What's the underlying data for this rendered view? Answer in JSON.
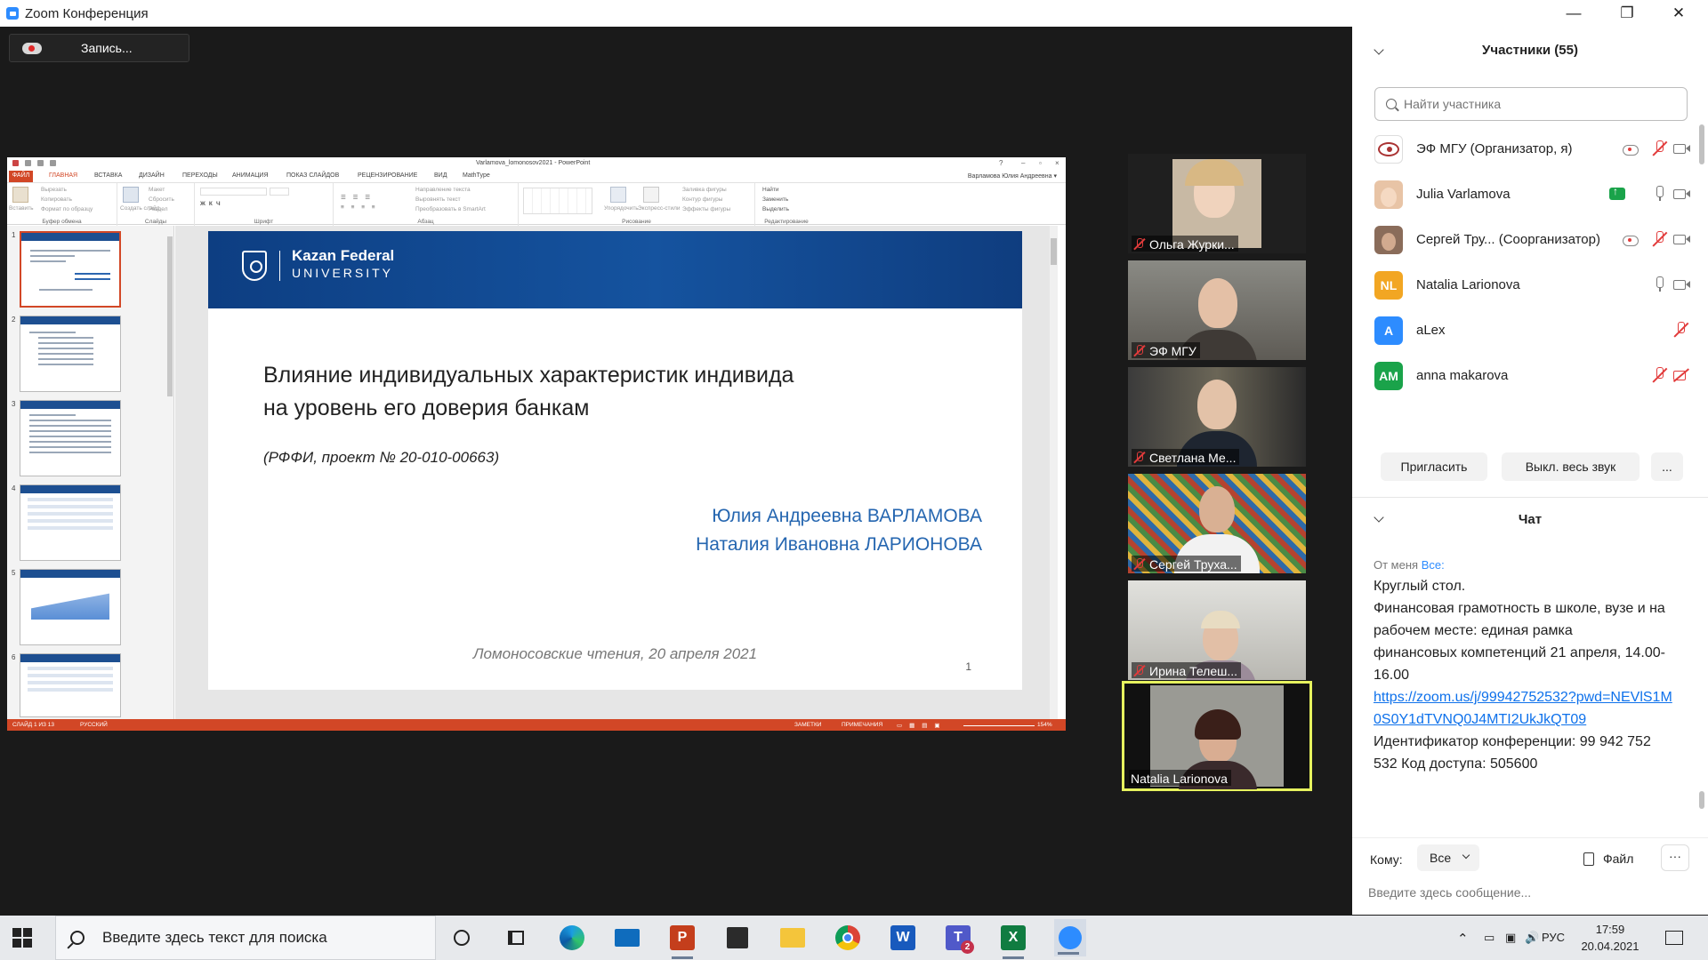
{
  "window": {
    "title": "Zoom Конференция",
    "minimize": "—",
    "restore": "❐",
    "close": "✕"
  },
  "recording": {
    "label": "Запись..."
  },
  "powerpoint": {
    "doc_title": "Varlamova_lomonosov2021 - PowerPoint",
    "tabs": [
      "ФАЙЛ",
      "ГЛАВНАЯ",
      "ВСТАВКА",
      "ДИЗАЙН",
      "ПЕРЕХОДЫ",
      "АНИМАЦИЯ",
      "ПОКАЗ СЛАЙДОВ",
      "РЕЦЕНЗИРОВАНИЕ",
      "ВИД",
      "MathType"
    ],
    "user": "Варламова Юлия Андреевна ▾",
    "ribbon": {
      "clipboard": {
        "label": "Буфер обмена",
        "paste": "Вставить",
        "cut": "Вырезать",
        "copy": "Копировать",
        "format": "Формат по образцу"
      },
      "slides": {
        "label": "Слайды",
        "create": "Создать слайд",
        "layout": "Макет",
        "reset": "Сбросить",
        "section": "Раздел"
      },
      "font": {
        "label": "Шрифт"
      },
      "paragraph": {
        "label": "Абзац",
        "direction": "Направление текста",
        "align": "Выровнять текст",
        "smartart": "Преобразовать в SmartArt"
      },
      "drawing": {
        "label": "Рисование",
        "arrange": "Упорядочить",
        "quick": "Экспресс-стили",
        "fill": "Заливка фигуры",
        "outline": "Контур фигуры",
        "effects": "Эффекты фигуры"
      },
      "editing": {
        "label": "Редактирование",
        "find": "Найти",
        "replace": "Заменить",
        "select": "Выделить"
      }
    },
    "slide": {
      "logo_name": "Kazan Federal",
      "logo_sub": "UNIVERSITY",
      "title_line1": "Влияние индивидуальных характеристик индивида",
      "title_line2": "на уровень его доверия банкам",
      "grant": "(РФФИ, проект № 20-010-00663)",
      "author1": "Юлия Андреевна ВАРЛАМОВА",
      "author2": "Наталия Ивановна ЛАРИОНОВА",
      "footer": "Ломоносовские чтения, 20 апреля 2021",
      "number": "1"
    },
    "thumbnail_numbers": [
      "1",
      "2",
      "3",
      "4",
      "5",
      "6"
    ],
    "status": {
      "slide": "СЛАЙД 1 ИЗ 13",
      "lang": "РУССКИЙ",
      "notes": "ЗАМЕТКИ",
      "comments": "ПРИМЕЧАНИЯ",
      "zoom": "154%"
    }
  },
  "videos": [
    {
      "name": "Ольга Журки...",
      "muted": true
    },
    {
      "name": "ЭФ МГУ",
      "muted": true
    },
    {
      "name": "Светлана Ме...",
      "muted": true
    },
    {
      "name": "Сергей Труха...",
      "muted": true
    },
    {
      "name": "Ирина Телеш...",
      "muted": true
    },
    {
      "name": "Natalia Larionova",
      "muted": false,
      "active": true
    }
  ],
  "participants_panel": {
    "title": "Участники (55)",
    "search_placeholder": "Найти участника",
    "participants": [
      {
        "name": "ЭФ МГУ (Организатор, я)",
        "avatar": "",
        "avatar_color": "#ffffff"
      },
      {
        "name": "Julia Varlamova",
        "avatar": "",
        "avatar_color": "#e8c4a6"
      },
      {
        "name": "Сергей Тру... (Соорганизатор)",
        "avatar": "",
        "avatar_color": "#8a6c5a"
      },
      {
        "name": "Natalia Larionova",
        "avatar": "NL",
        "avatar_color": "#f2a623"
      },
      {
        "name": "aLex",
        "avatar": "A",
        "avatar_color": "#2d8cff"
      },
      {
        "name": "anna makarova",
        "avatar": "AM",
        "avatar_color": "#1aa34a"
      }
    ],
    "invite": "Пригласить",
    "mute_all": "Выкл. весь звук",
    "more": "..."
  },
  "chat": {
    "title": "Чат",
    "from_label": "От меня",
    "to_label": "Все:",
    "message_lines": [
      "Круглый стол.",
      "Финансовая грамотность в школе, вузе и на рабочем месте: единая рамка",
      "финансовых компетенций 21 апреля, 14.00-16.00"
    ],
    "link": "https://zoom.us/j/99942752532?pwd=NEVlS1M0S0Y1dTVNQ0J4MTI2UkJkQT09",
    "message_tail": "Идентификатор конференции: 99 942 752 532 Код доступа: 505600",
    "to_prompt": "Кому:",
    "to_value": "Все",
    "file_label": "Файл",
    "more": "···",
    "input_placeholder": "Введите здесь сообщение..."
  },
  "taskbar": {
    "search_placeholder": "Введите здесь текст для поиска",
    "lang": "РУС",
    "time": "17:59",
    "date": "20.04.2021",
    "teams_badge": "2"
  }
}
